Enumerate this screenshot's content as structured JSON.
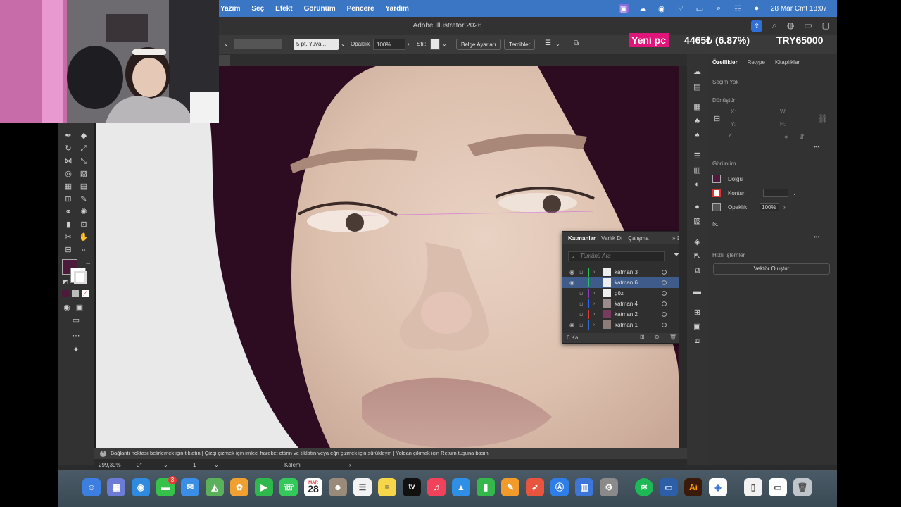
{
  "menubar": {
    "items": [
      "Yazım",
      "Seç",
      "Efekt",
      "Görünüm",
      "Pencere",
      "Yardım"
    ],
    "datetime": "28 Mar Cmt  18:07"
  },
  "window": {
    "title": "Adobe Illustrator 2026"
  },
  "controlbar": {
    "brush": "5 pt. Yuva...",
    "opacity_label": "Opaklık",
    "opacity_value": "100%",
    "style_label": "Stil:",
    "doc_setup": "Belge Ayarları",
    "prefs": "Tercihler"
  },
  "doctab": {
    "label": "me)"
  },
  "properties": {
    "tabs": [
      "Özellikler",
      "Retype",
      "Kitaplıklar"
    ],
    "no_selection": "Seçim Yok",
    "transform": "Dönüştür",
    "x": "X:",
    "y": "Y:",
    "w": "W:",
    "h": "H:",
    "appearance": "Görünüm",
    "fill": "Dolgu",
    "stroke": "Kontur",
    "opacity": "Opaklık",
    "opacity_value": "100%",
    "fx": "fx.",
    "quick_actions": "Hızlı İşlemler",
    "vectorize_button": "Vektör Oluştur"
  },
  "layers": {
    "tabs": [
      "Katmanlar",
      "Varlık Dı",
      "Çalışma"
    ],
    "search_placeholder": "Tümünü Ara",
    "rows": [
      {
        "name": "katman 3",
        "color": "#23c25a",
        "visible": true
      },
      {
        "name": "katman 6",
        "color": "#23c25a",
        "visible": true,
        "selected": true
      },
      {
        "name": "göz",
        "color": "#8a3cc9",
        "visible": false
      },
      {
        "name": "katman 4",
        "color": "#3366ff",
        "visible": false
      },
      {
        "name": "katman 2",
        "color": "#e03a3a",
        "visible": false
      },
      {
        "name": "katman 1",
        "color": "#2f6fd6",
        "visible": true
      }
    ],
    "footer": "6 Ka..."
  },
  "hint": "Bağlantı noktası belirlemek için tıklatın | Çizgi çizmek için imleci hareket ettirin ve tıklatın veya eğri çizmek için sürükleyin | Yoldan çıkmak için Return tuşuna basın",
  "statusbar": {
    "zoom": "299,39%",
    "rotation": "0°",
    "artboard": "1",
    "tool": "Kalem"
  },
  "dock": {
    "calendar_day": "28",
    "calendar_month": "MAR",
    "notification": "3",
    "ai_label": "Ai",
    "tv_label": "tv"
  },
  "ticker": {
    "badge": "Yeni pc",
    "amount": "4465₺ (6.87%)",
    "goal": "TRY65000"
  },
  "colors": {
    "fill": "#4d1a3c",
    "accent": "#3a76c4"
  }
}
